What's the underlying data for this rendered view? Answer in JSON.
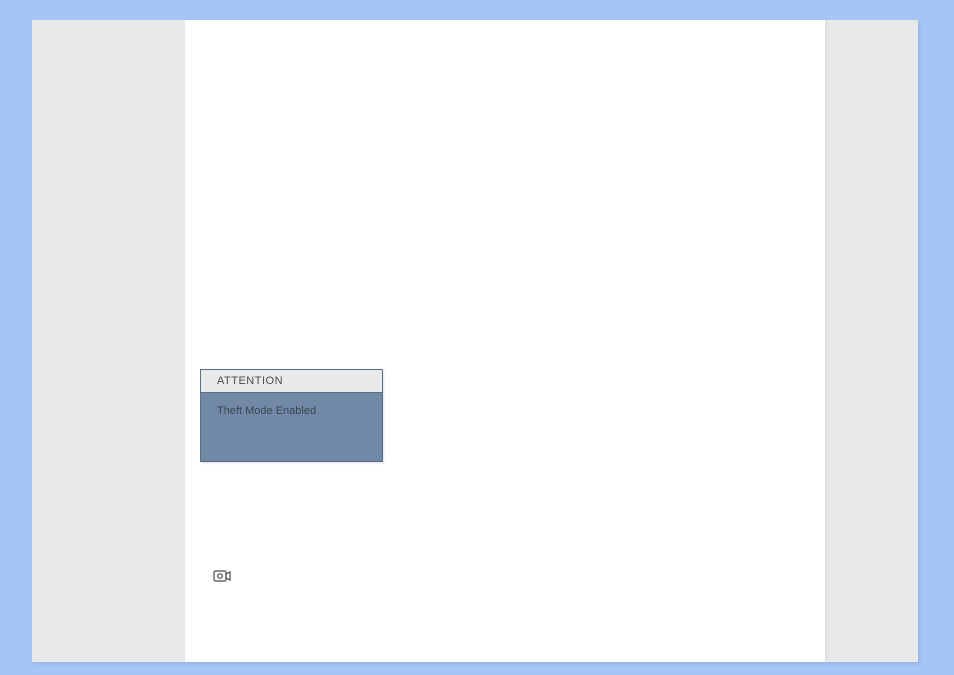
{
  "alert": {
    "title": "ATTENTION",
    "message": "Theft Mode Enabled"
  },
  "colors": {
    "page_bg": "#a6c5f5",
    "panel_bg": "#e9e9e9",
    "content_bg": "#ffffff",
    "alert_bg": "#7189a7",
    "alert_border": "#5a6f87"
  }
}
